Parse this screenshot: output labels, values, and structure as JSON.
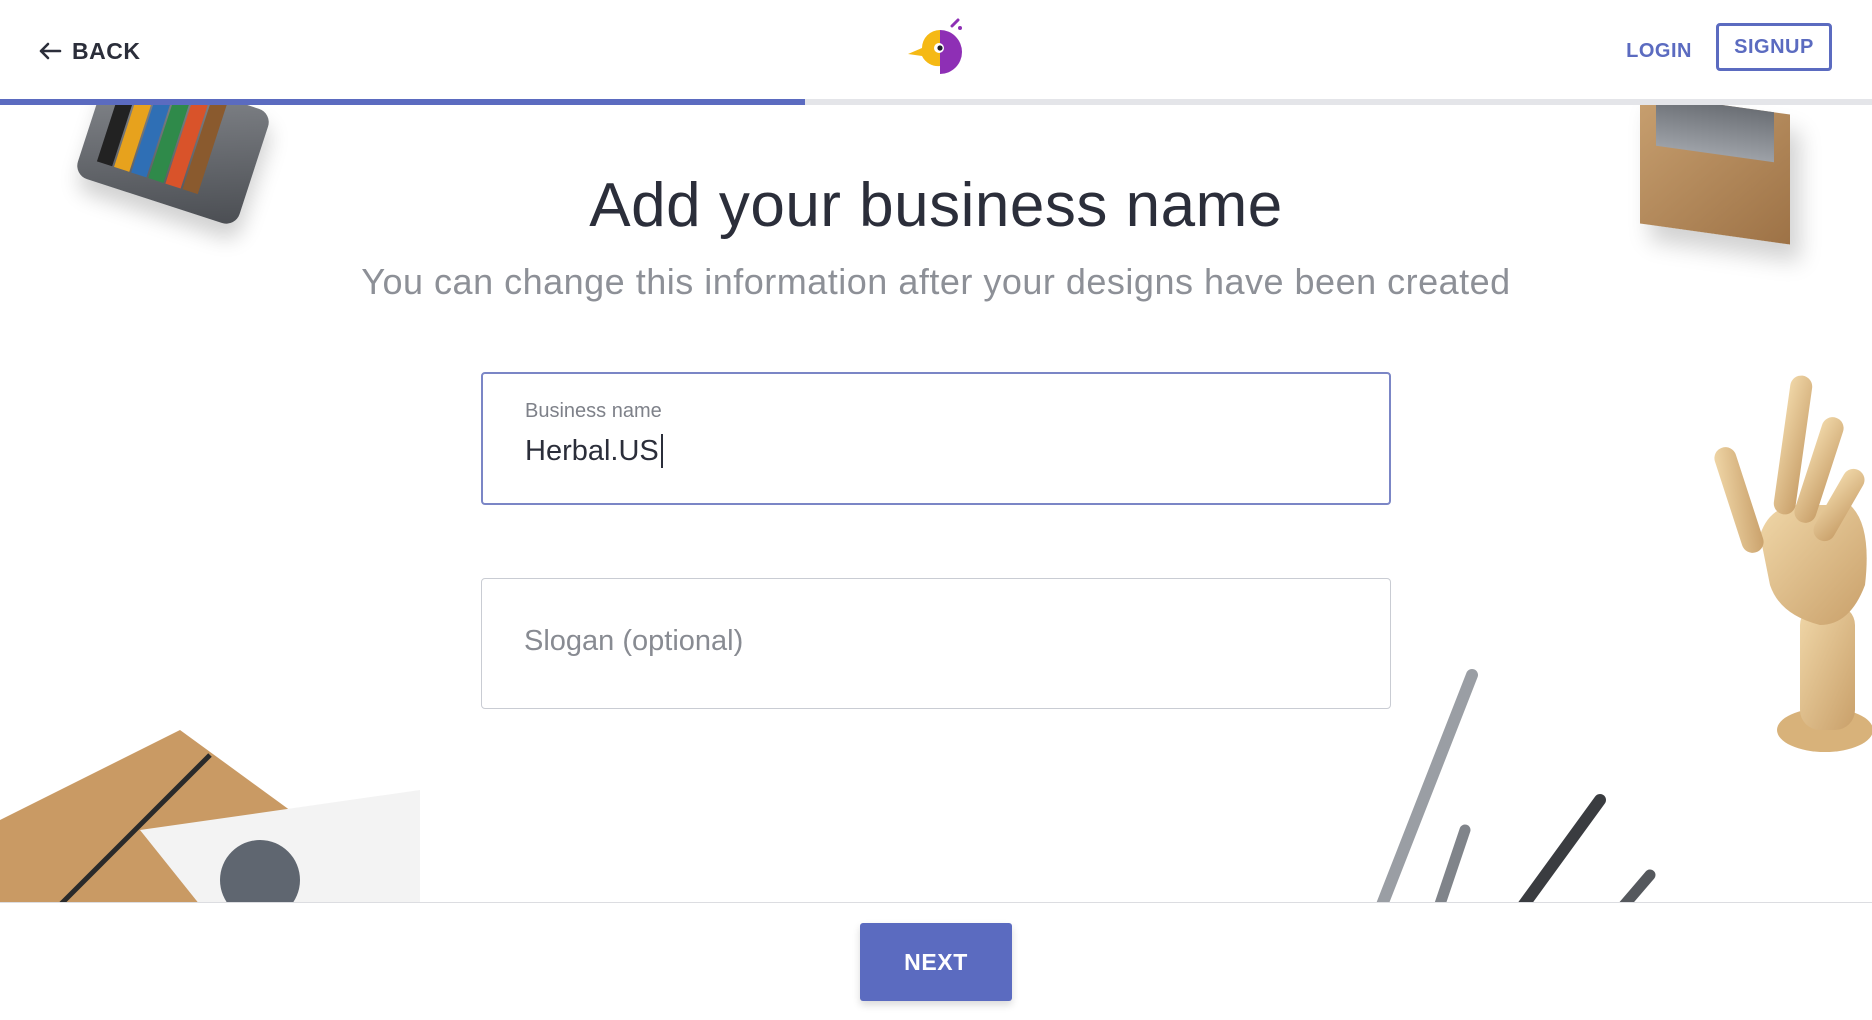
{
  "header": {
    "back_label": "BACK",
    "login_label": "LOGIN",
    "signup_label": "SIGNUP",
    "back_icon": "arrow-left-icon",
    "logo_icon": "bird-logo-icon"
  },
  "progress": {
    "value": 0.43
  },
  "main": {
    "title": "Add your business name",
    "subtitle": "You can change this information after your designs have been created",
    "business_field": {
      "label": "Business name",
      "value": "Herbal.US"
    },
    "slogan_field": {
      "placeholder": "Slogan (optional)",
      "value": ""
    }
  },
  "footer": {
    "next_label": "NEXT"
  },
  "colors": {
    "accent": "#5b6bc0",
    "text": "#2b2e3a",
    "muted": "#8d9097",
    "progress_track": "#e4e5e9"
  }
}
